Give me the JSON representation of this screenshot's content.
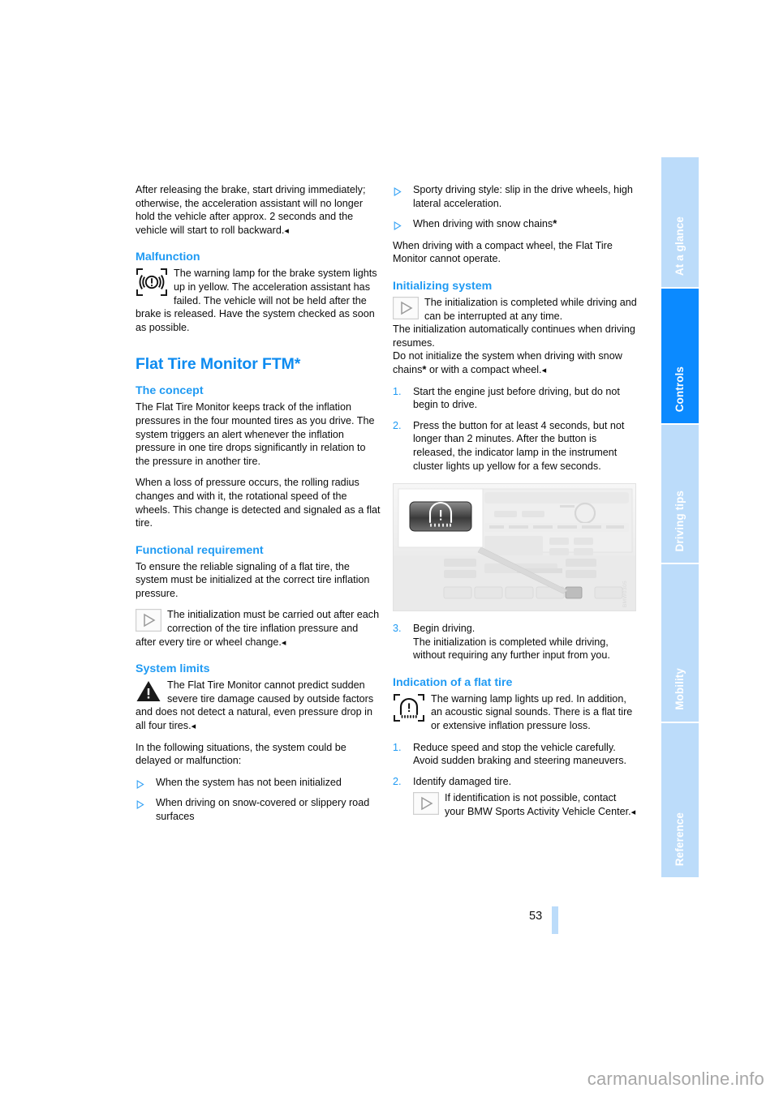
{
  "page": {
    "number": "53",
    "watermark": "carmanualsonline.info"
  },
  "tabs": [
    {
      "label": "At a glance",
      "active": false
    },
    {
      "label": "Controls",
      "active": true
    },
    {
      "label": "Driving tips",
      "active": false
    },
    {
      "label": "Mobility",
      "active": false
    },
    {
      "label": "Reference",
      "active": false
    }
  ],
  "colors": {
    "heading_blue": "#0d8bf0",
    "subheading_blue": "#1f9af3",
    "tab_active": "#0b8aff",
    "tab_inactive": "#bcdcfa",
    "body_text": "#0b0b0b"
  },
  "left_column": {
    "intro_paragraph": "After releasing the brake, start driving immediately; otherwise, the acceleration assistant will no longer hold the vehicle after approx. 2 seconds and the vehicle will start to roll backward.",
    "malfunction": {
      "heading": "Malfunction",
      "icon": "brake-warning-lamp-icon",
      "note_text": "The warning lamp for the brake system lights up in yellow. The acceleration assistant has failed. The vehicle will not be held after the brake is released. Have the system checked as soon as possible."
    },
    "ftm": {
      "title": "Flat Tire Monitor FTM",
      "title_star": "*",
      "concept": {
        "heading": "The concept",
        "paragraph_1": "The Flat Tire Monitor keeps track of the inflation pressures in the four mounted tires as you drive. The system triggers an alert whenever the inflation pressure in one tire drops significantly in relation to the pressure in another tire.",
        "paragraph_2": "When a loss of pressure occurs, the rolling radius changes and with it, the rotational speed of the wheels. This change is detected and signaled as a flat tire."
      },
      "functional_requirement": {
        "heading": "Functional requirement",
        "paragraph": "To ensure the reliable signaling of a flat tire, the system must be initialized at the correct tire inflation pressure.",
        "icon": "note-triangle-icon",
        "note_text": "The initialization must be carried out after each correction of the tire inflation pressure and after every tire or wheel change."
      },
      "system_limits": {
        "heading": "System limits",
        "icon": "warning-triangle-icon",
        "warning_text": "The Flat Tire Monitor cannot predict sudden severe tire damage caused by outside factors and does not detect a natural, even pressure drop in all four tires.",
        "intro": "In the following situations, the system could be delayed or malfunction:",
        "bullets": [
          "When the system has not been initialized",
          "When driving on snow-covered or slippery road surfaces"
        ]
      }
    }
  },
  "right_column": {
    "continued_bullets": [
      {
        "text": "Sporty driving style: slip in the drive wheels, high lateral acceleration.",
        "star": ""
      },
      {
        "text": "When driving with snow chains",
        "star": "*"
      }
    ],
    "compact_wheel_note": "When driving with a compact wheel, the Flat Tire Monitor cannot operate.",
    "initializing": {
      "heading": "Initializing system",
      "icon": "note-triangle-icon",
      "note_text": "The initialization is completed while driving and can be interrupted at any time.",
      "paragraph_1": "The initialization automatically continues when driving resumes.",
      "paragraph_2_before": "Do not initialize the system when driving with snow chains",
      "paragraph_2_star": "*",
      "paragraph_2_after": " or with a compact wheel.",
      "steps": [
        {
          "num": "1.",
          "text": "Start the engine just before driving, but do not begin to drive."
        },
        {
          "num": "2.",
          "text": "Press the button for at least 4 seconds, but not longer than 2 minutes. After the button is released, the indicator lamp in the instrument cluster lights up yellow for a few seconds."
        }
      ],
      "figure": {
        "name": "center-console-ftm-button-photo",
        "code": "BMW0305"
      },
      "step3": {
        "num": "3.",
        "line1": "Begin driving.",
        "line2": "The initialization is completed while driving, without requiring any further input from you."
      }
    },
    "indication": {
      "heading": "Indication of a flat tire",
      "icon": "tire-pressure-warning-icon",
      "note_text": "The warning lamp lights up red. In addition, an acoustic signal sounds. There is a flat tire or extensive inflation pressure loss.",
      "steps": [
        {
          "num": "1.",
          "text": "Reduce speed and stop the vehicle carefully. Avoid sudden braking and steering maneuvers."
        },
        {
          "num": "2.",
          "text": "Identify damaged tire."
        }
      ],
      "sub_note": {
        "icon": "note-triangle-icon",
        "text": "If identification is not possible, contact your BMW Sports Activity Vehicle Center."
      }
    }
  }
}
